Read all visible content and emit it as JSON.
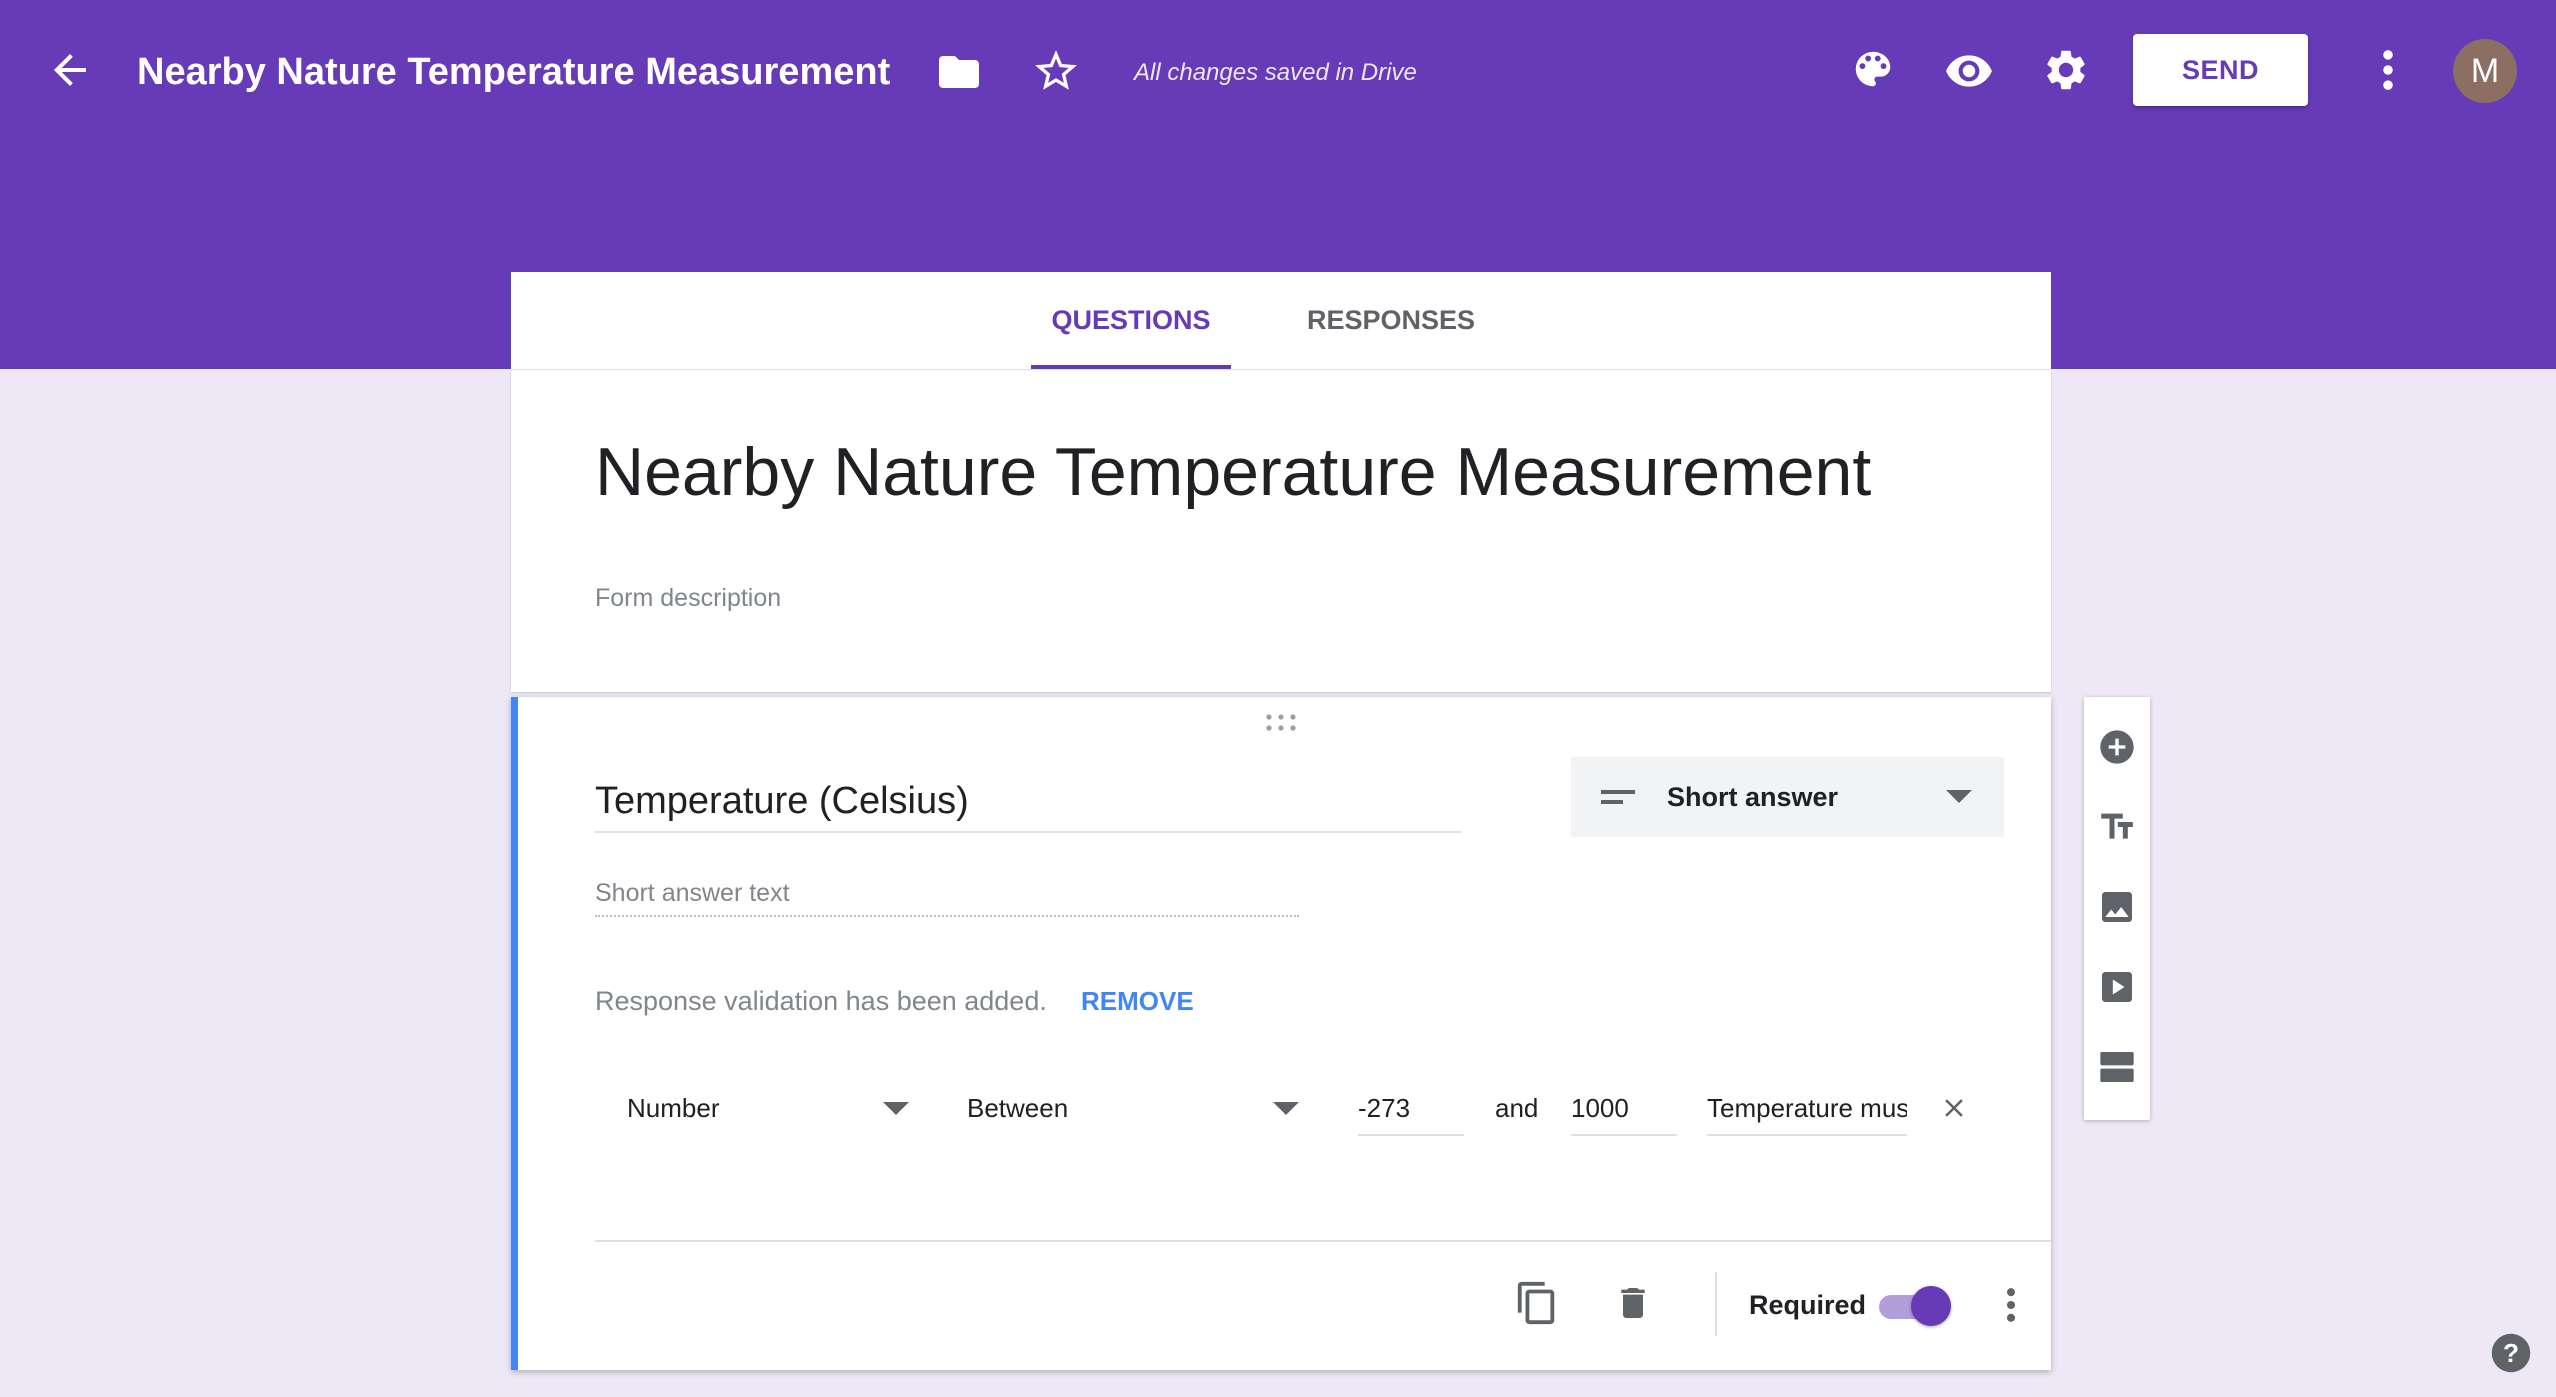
{
  "header": {
    "back_icon": "arrow-back-icon",
    "title": "Nearby Nature Temperature Measurement",
    "folder_icon": "folder-icon",
    "star_icon": "star-outline-icon",
    "save_status": "All changes saved in Drive",
    "palette_icon": "palette-icon",
    "preview_icon": "eye-icon",
    "settings_icon": "gear-icon",
    "send_label": "SEND",
    "more_icon": "more-vertical-icon",
    "avatar_letter": "M"
  },
  "tabs": [
    {
      "label": "QUESTIONS",
      "active": true
    },
    {
      "label": "RESPONSES",
      "active": false
    }
  ],
  "form": {
    "title": "Nearby Nature Temperature Measurement",
    "description_placeholder": "Form description"
  },
  "question": {
    "title": "Temperature (Celsius)",
    "type_label": "Short answer",
    "answer_placeholder": "Short answer text",
    "validation_message": "Response validation has been added.",
    "remove_label": "REMOVE",
    "validation": {
      "type": "Number",
      "condition": "Between",
      "min": "-273",
      "and_label": "and",
      "max": "1000",
      "error_text": "Temperature mus"
    },
    "required_label": "Required",
    "required": true
  },
  "colors": {
    "header": "#673ab7",
    "background": "#ede7f6",
    "accent": "#673ab7",
    "active_card_border": "#4285f4",
    "link": "#4285f4"
  },
  "side_toolbar": [
    "add-question-icon",
    "title-text-icon",
    "image-icon",
    "video-icon",
    "section-icon"
  ],
  "help_icon": "help-icon"
}
